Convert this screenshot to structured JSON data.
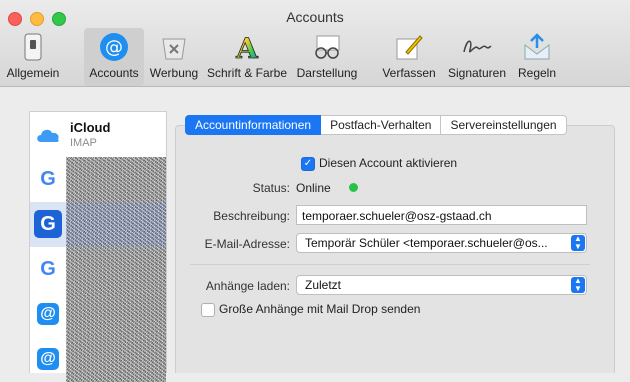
{
  "window": {
    "title": "Accounts"
  },
  "toolbar": {
    "items": [
      {
        "label": "Allgemein",
        "icon": "switch-icon"
      },
      {
        "label": "Accounts",
        "icon": "at-icon"
      },
      {
        "label": "Werbung",
        "icon": "junk-mail-icon"
      },
      {
        "label": "Schrift & Farbe",
        "icon": "font-color-icon"
      },
      {
        "label": "Darstellung",
        "icon": "glasses-icon"
      },
      {
        "label": "Verfassen",
        "icon": "pen-icon"
      },
      {
        "label": "Signaturen",
        "icon": "signature-icon"
      },
      {
        "label": "Regeln",
        "icon": "rules-icon"
      }
    ]
  },
  "sidebar": {
    "accounts": [
      {
        "name": "iCloud",
        "type": "IMAP",
        "icon": "cloud-icon"
      },
      {
        "icon": "google-icon",
        "glyph": "G"
      },
      {
        "icon": "google-icon",
        "glyph": "G",
        "selected": true
      },
      {
        "icon": "google-icon",
        "glyph": "G"
      },
      {
        "icon": "at-icon",
        "glyph": "@"
      },
      {
        "icon": "at-icon",
        "glyph": "@"
      }
    ]
  },
  "tabs": [
    {
      "label": "Accountinformationen",
      "active": true
    },
    {
      "label": "Postfach-Verhalten"
    },
    {
      "label": "Servereinstellungen"
    }
  ],
  "form": {
    "enable_label": "Diesen Account aktivieren",
    "enable_checked": true,
    "status_label": "Status:",
    "status_value": "Online",
    "status_color": "#27c24a",
    "description_label": "Beschreibung:",
    "description_value": "temporaer.schueler@osz-gstaad.ch",
    "email_label": "E-Mail-Adresse:",
    "email_value": "Temporär Schüler <temporaer.schueler@os...",
    "attachments_label": "Anhänge laden:",
    "attachments_value": "Zuletzt",
    "maildrop_label": "Große Anhänge mit Mail Drop senden",
    "maildrop_checked": false
  },
  "colors": {
    "accent": "#1a76f2",
    "online": "#27c24a"
  }
}
